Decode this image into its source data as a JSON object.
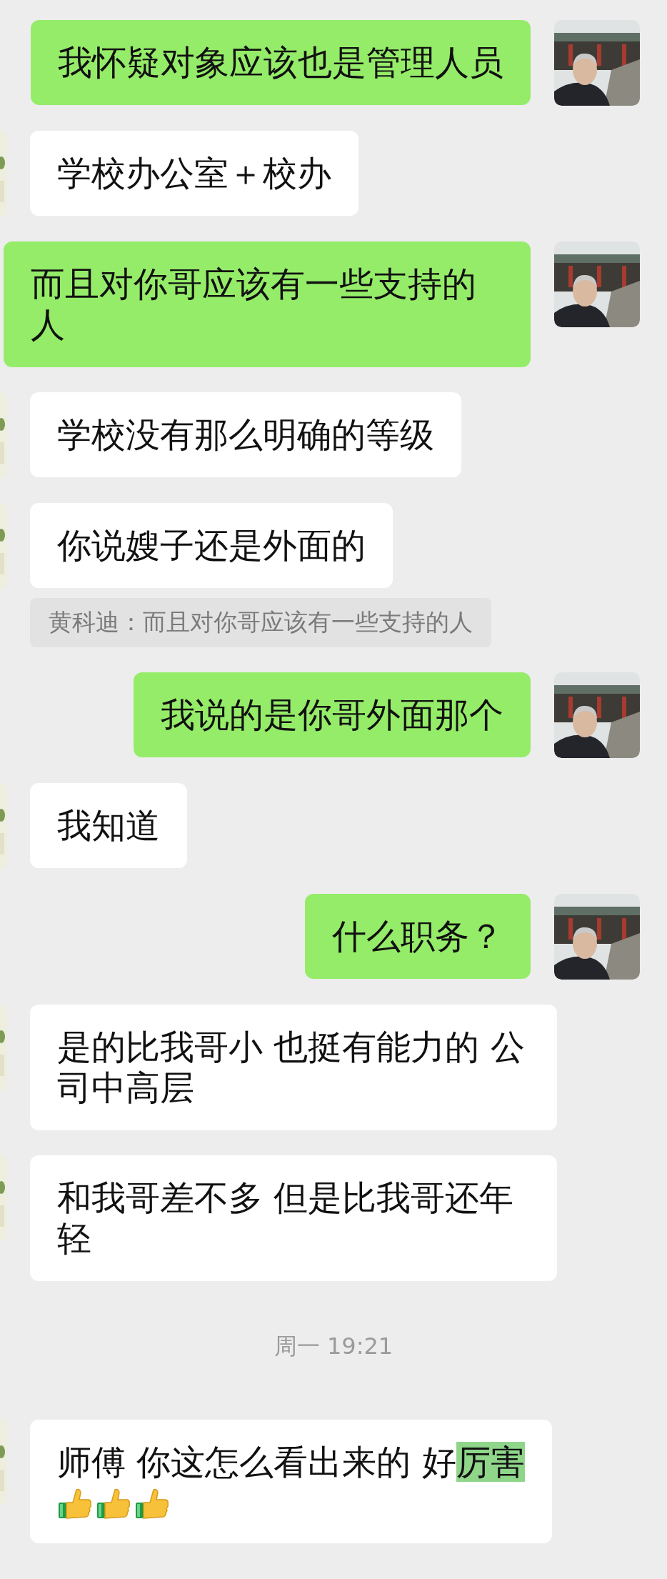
{
  "messages": [
    {
      "kind": "sent",
      "text": "我怀疑对象应该也是管理人员"
    },
    {
      "kind": "received",
      "text": "学校办公室＋校办"
    },
    {
      "kind": "sent",
      "text": "而且对你哥应该有一些支持的人"
    },
    {
      "kind": "received",
      "text": "学校没有那么明确的等级"
    },
    {
      "kind": "received",
      "text": "你说嫂子还是外面的"
    },
    {
      "kind": "quote",
      "text": "黄科迪：而且对你哥应该有一些支持的人"
    },
    {
      "kind": "sent",
      "text": "我说的是你哥外面那个"
    },
    {
      "kind": "received",
      "text": "我知道"
    },
    {
      "kind": "sent",
      "text": "什么职务？"
    },
    {
      "kind": "received",
      "text": "是的比我哥小 也挺有能力的 公司中高层"
    },
    {
      "kind": "received",
      "text": "和我哥差不多 但是比我哥还年轻"
    },
    {
      "kind": "time",
      "text": "周一 19:21"
    },
    {
      "kind": "received",
      "text": "师傅 你这怎么看出来的 好",
      "selected_text": "厉害",
      "emojis": [
        {
          "kind": "thumbs-up"
        },
        {
          "kind": "thumbs-up"
        },
        {
          "kind": "thumbs-up"
        }
      ]
    }
  ]
}
